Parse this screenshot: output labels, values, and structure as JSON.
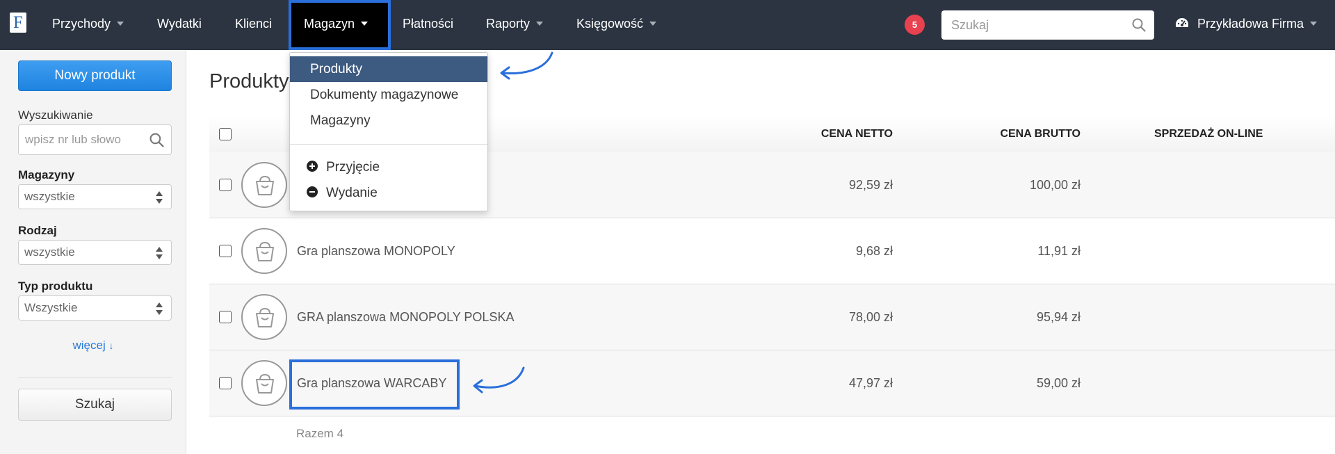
{
  "app": {
    "logo_letter": "F",
    "accent_color": "#2a6fdb",
    "topbar_color": "#2b3440"
  },
  "nav": {
    "items": [
      {
        "label": "Przychody",
        "has_caret": true
      },
      {
        "label": "Wydatki",
        "has_caret": false
      },
      {
        "label": "Klienci",
        "has_caret": false
      },
      {
        "label": "Magazyn",
        "has_caret": true,
        "active": true
      },
      {
        "label": "Płatności",
        "has_caret": false
      },
      {
        "label": "Raporty",
        "has_caret": true
      },
      {
        "label": "Księgowość",
        "has_caret": true
      }
    ],
    "notifications_count": "5",
    "search_placeholder": "Szukaj",
    "search_icon": "search-icon",
    "company_label": "Przykładowa Firma",
    "company_icon": "dashboard-icon"
  },
  "dropdown": {
    "items": [
      {
        "label": "Produkty",
        "active": true
      },
      {
        "label": "Dokumenty magazynowe"
      },
      {
        "label": "Magazyny"
      }
    ],
    "actions": [
      {
        "label": "Przyjęcie",
        "icon": "plus-circle-icon"
      },
      {
        "label": "Wydanie",
        "icon": "minus-circle-icon"
      }
    ]
  },
  "sidebar": {
    "new_button": "Nowy produkt",
    "search_label": "Wyszukiwanie",
    "search_placeholder": "wpisz nr lub słowo",
    "filters": [
      {
        "label": "Magazyny",
        "value": "wszystkie"
      },
      {
        "label": "Rodzaj",
        "value": "wszystkie"
      },
      {
        "label": "Typ produktu",
        "value": "Wszystkie"
      }
    ],
    "more_link": "więcej",
    "search_button": "Szukaj"
  },
  "main": {
    "title": "Produkty",
    "columns": {
      "net": "CENA NETTO",
      "gross": "CENA BRUTTO",
      "online": "SPRZEDAŻ ON-LINE"
    },
    "rows": [
      {
        "name": "",
        "net": "92,59 zł",
        "gross": "100,00 zł"
      },
      {
        "name": "Gra planszowa MONOPOLY",
        "net": "9,68 zł",
        "gross": "11,91 zł"
      },
      {
        "name": "GRA planszowa MONOPOLY POLSKA",
        "net": "78,00 zł",
        "gross": "95,94 zł"
      },
      {
        "name": "Gra planszowa WARCABY",
        "net": "47,97 zł",
        "gross": "59,00 zł",
        "highlighted": true
      }
    ],
    "total": "Razem 4"
  }
}
